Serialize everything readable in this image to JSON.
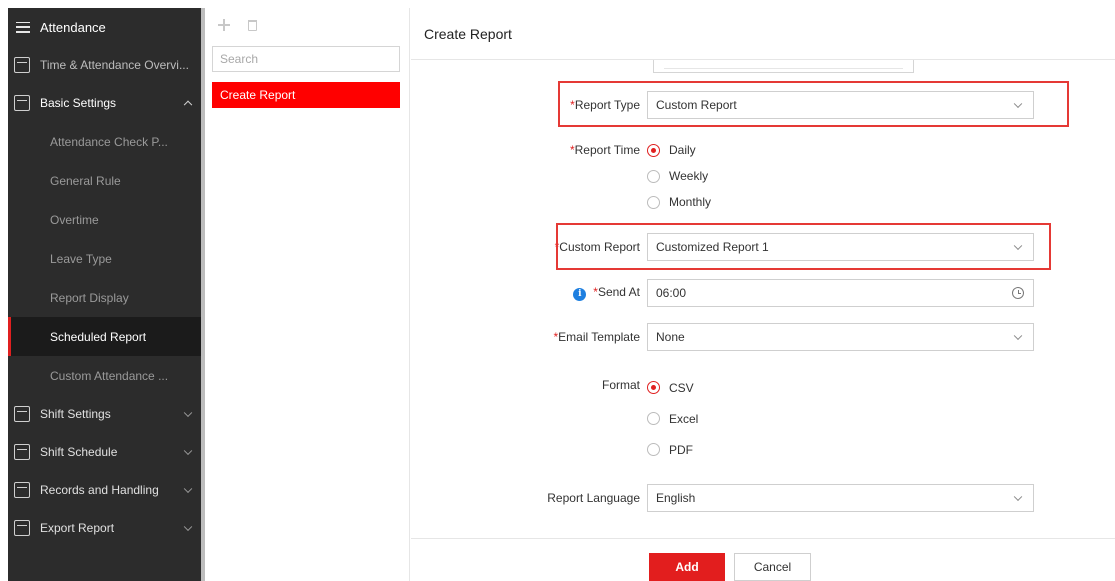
{
  "sidebar": {
    "header": "Attendance",
    "items": [
      {
        "label": "Time & Attendance Overvi...",
        "icon": "overview-icon"
      },
      {
        "label": "Basic Settings",
        "icon": "settings-icon",
        "expanded": true
      },
      {
        "label": "Shift Settings",
        "icon": "calendar-check-icon"
      },
      {
        "label": "Shift Schedule",
        "icon": "calendar-icon"
      },
      {
        "label": "Records and Handling",
        "icon": "calendar-grid-icon"
      },
      {
        "label": "Export Report",
        "icon": "calendar-chart-icon"
      }
    ],
    "basic_settings_children": [
      "Attendance Check P...",
      "General Rule",
      "Overtime",
      "Leave Type",
      "Report Display",
      "Scheduled Report",
      "Custom Attendance ..."
    ],
    "active_child": "Scheduled Report"
  },
  "list": {
    "search_placeholder": "Search",
    "items": [
      "Create Report"
    ]
  },
  "main": {
    "title": "Create Report",
    "report_type": {
      "label": "Report Type",
      "value": "Custom Report"
    },
    "report_time": {
      "label": "Report Time",
      "options": [
        "Daily",
        "Weekly",
        "Monthly"
      ],
      "selected": "Daily"
    },
    "custom_report": {
      "label": "Custom Report",
      "value": "Customized Report 1"
    },
    "send_at": {
      "label": "Send At",
      "value": "06:00"
    },
    "email_template": {
      "label": "Email Template",
      "value": "None"
    },
    "format": {
      "label": "Format",
      "options": [
        "CSV",
        "Excel",
        "PDF"
      ],
      "selected": "CSV"
    },
    "report_language": {
      "label": "Report Language",
      "value": "English"
    },
    "add_label": "Add",
    "cancel_label": "Cancel"
  },
  "colors": {
    "accent": "#e21e1e",
    "sidebar_bg": "#2c2c2c",
    "highlight_border": "#e53935",
    "info_icon": "#1e7fe0"
  }
}
